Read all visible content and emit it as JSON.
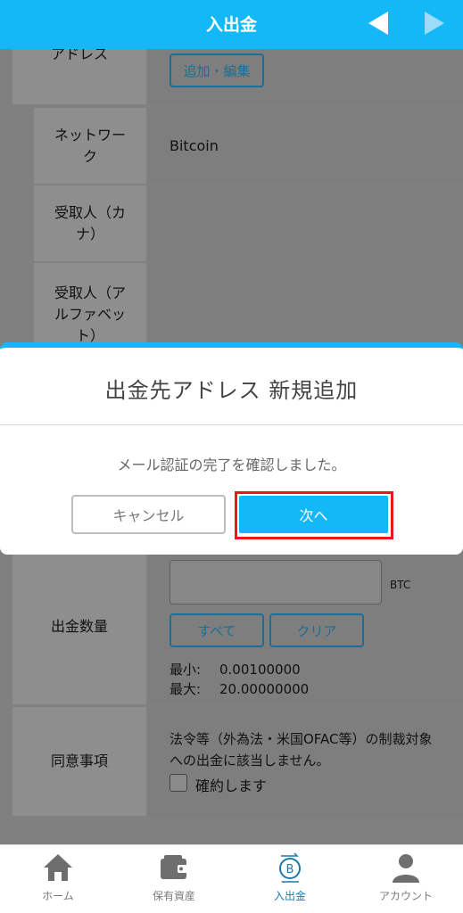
{
  "header": {
    "title": "入出金",
    "prev_icon": "triangle-left-icon",
    "next_icon": "triangle-right-icon"
  },
  "form": {
    "address_label_partial": "アドレス",
    "add_edit_button": "追加・編集",
    "network_label": "ネットワーク",
    "network_value": "Bitcoin",
    "recipient_kana_label": "受取人（カナ）",
    "recipient_alpha_label": "受取人（アルファベット）",
    "amount_label": "出金数量",
    "amount_value": "",
    "amount_unit": "BTC",
    "all_button": "すべて",
    "clear_button": "クリア",
    "min_label": "最小:",
    "min_value": "0.00100000",
    "max_label": "最大:",
    "max_value": "20.00000000",
    "consent_label": "同意事項",
    "consent_text": "法令等（外為法・米国OFAC等）の制裁対象への出金に該当しません。",
    "confirm_checkbox_label": "確約します"
  },
  "modal": {
    "title": "出金先アドレス 新規追加",
    "message": "メール認証の完了を確認しました。",
    "cancel_button": "キャンセル",
    "next_button": "次へ"
  },
  "tabbar": {
    "items": [
      {
        "label": "ホーム",
        "icon": "home-icon"
      },
      {
        "label": "保有資産",
        "icon": "wallet-icon"
      },
      {
        "label": "入出金",
        "icon": "bitcoin-transfer-icon"
      },
      {
        "label": "アカウント",
        "icon": "user-icon"
      }
    ],
    "active_index": 2
  },
  "colors": {
    "accent": "#15b8f6",
    "highlight": "#e8191d",
    "link": "#1b6f95"
  }
}
